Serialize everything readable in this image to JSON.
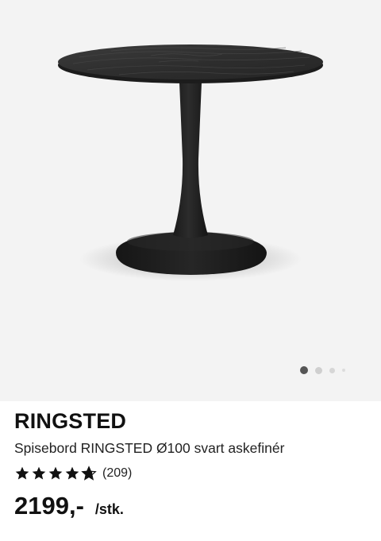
{
  "product": {
    "name": "RINGSTED",
    "description": "Spisebord RINGSTED Ø100 svart askefinér",
    "rating": {
      "stars": 4.7,
      "max_stars": 5,
      "count_label": "(209)"
    },
    "price": "2199,-",
    "unit": "/stk."
  },
  "carousel": {
    "total_slides": 4,
    "active_index": 0
  },
  "image": {
    "subject": "round black table with ash veneer top and tulip pedestal base",
    "background_color": "#f3f3f3"
  },
  "colors": {
    "star": "#111111",
    "dot_active": "#555555",
    "dot_inactive": "#cfcfcf"
  }
}
